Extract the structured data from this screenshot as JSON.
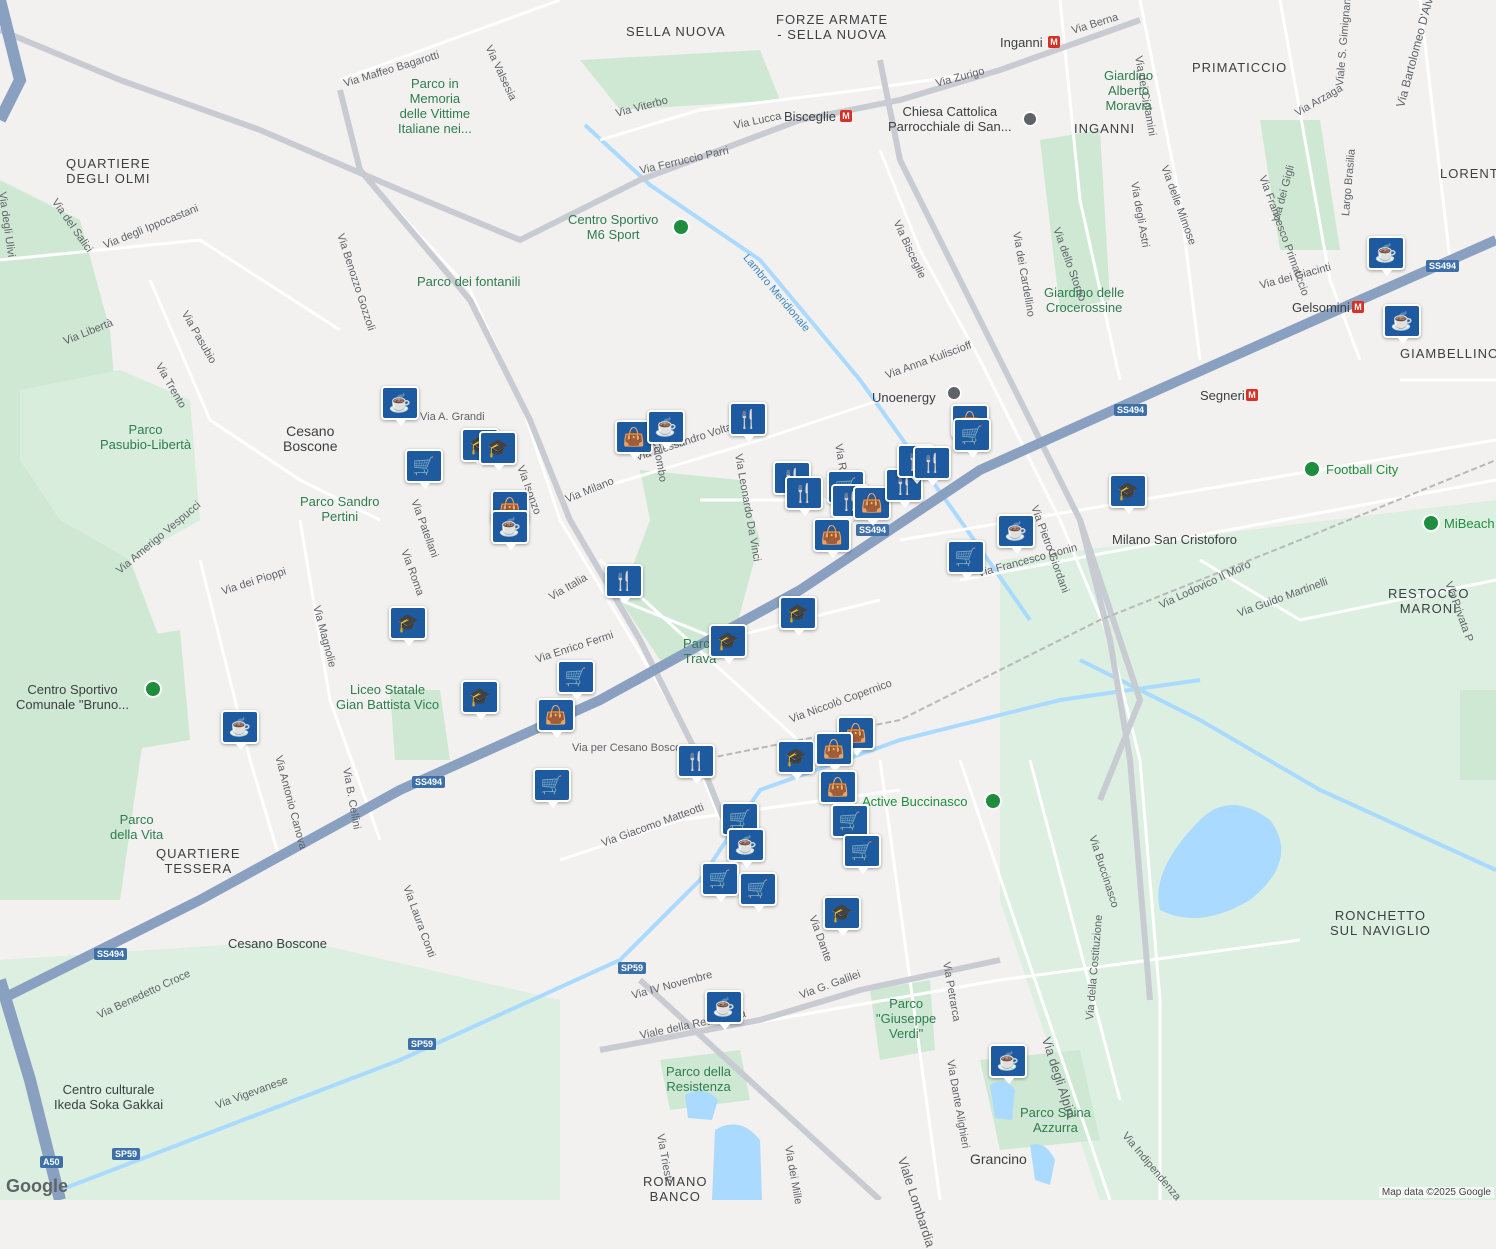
{
  "districts": [
    {
      "key": "sella-nuova",
      "text": "SELLA NUOVA"
    },
    {
      "key": "forze-armate",
      "text": "FORZE ARMATE\n- SELLA NUOVA"
    },
    {
      "key": "primaticcio",
      "text": "PRIMATICCIO"
    },
    {
      "key": "inganni",
      "text": "INGANNI"
    },
    {
      "key": "lorenteggio",
      "text": "LORENT"
    },
    {
      "key": "quartiere-olmi",
      "text": "QUARTIERE\nDEGLI OLMI"
    },
    {
      "key": "giambellino",
      "text": "GIAMBELLINO"
    },
    {
      "key": "restocco",
      "text": "RESTOCCO\nMARONI"
    },
    {
      "key": "quartiere-tessera",
      "text": "QUARTIERE\nTESSERA"
    },
    {
      "key": "ronchetto",
      "text": "RONCHETTO\nSUL NAVIGLIO"
    },
    {
      "key": "romano-banco",
      "text": "ROMANO\nBANCO"
    },
    {
      "key": "cesano-boscone",
      "text": "Cesano\nBoscone"
    },
    {
      "key": "grancino",
      "text": "Grancino"
    }
  ],
  "streets": [
    "Via Maffeo Bagarotti",
    "Via Valsesia",
    "Via Viterbo",
    "Via Lucca",
    "Via Ferruccio Parri",
    "Via Zurigo",
    "Via Berna",
    "Via degli Ulivi",
    "Via del Salici",
    "Via degli Ippocastani",
    "Via Benozzo Gozzoli",
    "Via Pasubio",
    "Via Gorizia",
    "Via Libertà",
    "Via Trento",
    "Via A. Grandi",
    "Via Isonzo",
    "Via Milano",
    "Via Alessandro Volta",
    "Via Colombo",
    "Via Leonardo Da Vinci",
    "Via Robert Koch",
    "Via Anna Kuliscioff",
    "Via Bisceglie",
    "Via Pietro Giordani",
    "Via Francesco Gonin",
    "Via Lodovico Il Moro",
    "Via Guido Martinelli",
    "Via Patellani",
    "Via Roma",
    "Via Amerigo Vespucci",
    "Via dei Pioppi",
    "Via Magnolie",
    "Via Italia",
    "Via Enrico Fermi",
    "Via per Cesano Boscone",
    "Via Niccolò Copernico",
    "Via Antonio Canova",
    "Via B. Cellini",
    "Via Laura Conti",
    "Via Giacomo Matteotti",
    "Via Benedetto Croce",
    "Via Vigevanese",
    "Via IV Novembre",
    "Viale della Resistenza",
    "Via G. Galilei",
    "Via Dante",
    "Via Petrarca",
    "Via Dante Alighieri",
    "Viale Lombardia",
    "Via degli Alpini",
    "Via della Costituzione",
    "Via Indipendenza",
    "Via Buccinasco",
    "Via dei Mille",
    "Via Trieste",
    "Via dello Storno",
    "Via dei Cardellino",
    "Via degli Astri",
    "Via delle Mimose",
    "Via dei Ciclamini",
    "Via Arzaga",
    "Via Francesco Primaticcio",
    "Via dei Gigli",
    "Via dei Giacinti",
    "Largo Brasilia",
    "Viale S. Gimignano",
    "Via Bartolomeo D'Alviano",
    "Via Privata P"
  ],
  "parks": [
    {
      "key": "parco-vittime",
      "text": "Parco in\nMemoria\ndelle Vittime\nItaliane nei..."
    },
    {
      "key": "parco-fontanili",
      "text": "Parco dei fontanili"
    },
    {
      "key": "parco-pasubio",
      "text": "Parco\nPasubio-Libertà"
    },
    {
      "key": "parco-pertini",
      "text": "Parco Sandro\nPertini"
    },
    {
      "key": "parco-vita",
      "text": "Parco\ndella Vita"
    },
    {
      "key": "parco-travaglia",
      "text": "Parco\nTrava"
    },
    {
      "key": "giardino-moravia",
      "text": "Giardino\nAlberto\nMoravia"
    },
    {
      "key": "giardino-crocerossine",
      "text": "Giardino delle\nCrocerossine"
    },
    {
      "key": "parco-verdi",
      "text": "Parco\n\"Giuseppe\nVerdi\""
    },
    {
      "key": "parco-resistenza",
      "text": "Parco della\nResistenza"
    },
    {
      "key": "parco-spina",
      "text": "Parco Spina\nAzzurra"
    }
  ],
  "pois": [
    {
      "key": "centro-sportivo-m6",
      "text": "Centro Sportivo\nM6 Sport"
    },
    {
      "key": "chiesa",
      "text": "Chiesa Cattolica\nParrocchiale di San..."
    },
    {
      "key": "unoenergy",
      "text": "Unoenergy"
    },
    {
      "key": "football-city",
      "text": "Football City"
    },
    {
      "key": "mibeach",
      "text": "MiBeach"
    },
    {
      "key": "milano-san-cristoforo",
      "text": "Milano San Cristoforo"
    },
    {
      "key": "centro-bruno",
      "text": "Centro Sportivo\nComunale \"Bruno..."
    },
    {
      "key": "liceo-vico",
      "text": "Liceo Statale\nGian Battista Vico"
    },
    {
      "key": "active-buccinasco",
      "text": "Active Buccinasco"
    },
    {
      "key": "cesano-boscone-station",
      "text": "Cesano Boscone"
    },
    {
      "key": "centro-ikeda",
      "text": "Centro culturale\nIkeda Soka Gakkai"
    },
    {
      "key": "lambro",
      "text": "Lambro Meridionale"
    },
    {
      "key": "bisceglie-metro",
      "text": "Bisceglie"
    },
    {
      "key": "inganni-metro",
      "text": "Inganni"
    },
    {
      "key": "gelsomini-metro",
      "text": "Gelsomini"
    },
    {
      "key": "segneri-metro",
      "text": "Segneri"
    },
    {
      "key": "buccinasco-label",
      "text": "Buccinasco"
    }
  ],
  "road_shields": [
    "SS494",
    "SS494",
    "SS494",
    "SS494",
    "SS494",
    "SP59",
    "SP59",
    "SP59",
    "A50"
  ],
  "pin_icons": {
    "cafe": "cafe-icon",
    "school": "school-icon",
    "shop": "shopping-bag-icon",
    "grocery": "shopping-cart-icon",
    "restaurant": "restaurant-icon"
  },
  "colors": {
    "pin": "#1e5aa0",
    "highway": "#8aa0c0",
    "park": "#cfe8d4",
    "water": "#aadaff"
  },
  "attribution": "Map data ©2025 Google",
  "logo": "Google"
}
